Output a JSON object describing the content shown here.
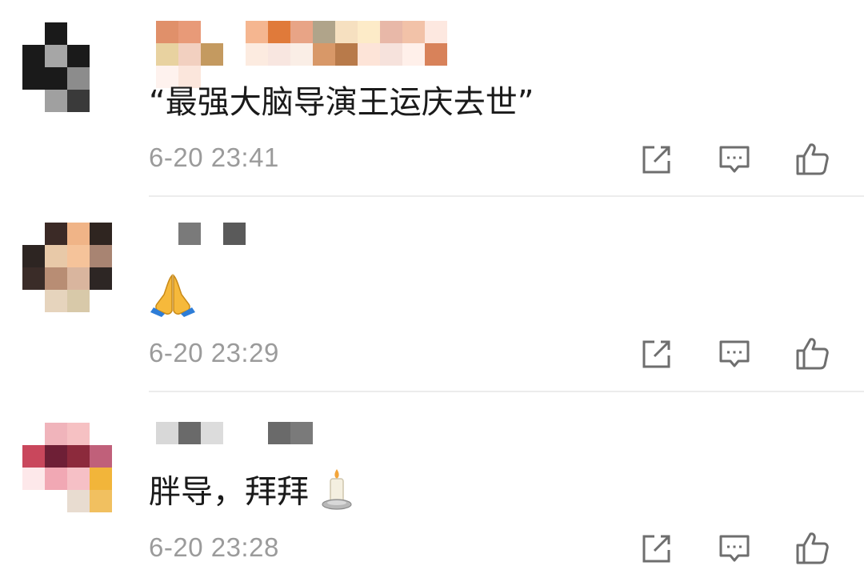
{
  "comments": [
    {
      "content": "“最强大脑导演王运庆去世”",
      "time": "6-20 23:41",
      "avatar_colors": [
        "#ffffff",
        "#1a1a1a",
        "#ffffff",
        "#ffffff",
        "#1a1a1a",
        "#a6a6a6",
        "#1a1a1a",
        "#ffffff",
        "#1a1a1a",
        "#1a1a1a",
        "#8c8c8c",
        "#ffffff",
        "#ffffff",
        "#a0a0a0",
        "#3a3a3a",
        "#ffffff"
      ]
    },
    {
      "content_emoji": "folded-hands-emoji",
      "time": "6-20 23:29",
      "avatar_colors": [
        "#ffffff",
        "#3b2a26",
        "#f0b487",
        "#2f2520",
        "#2d2522",
        "#e8c9a8",
        "#f5c39a",
        "#a88472",
        "#3a2c28",
        "#b88d74",
        "#d9b59e",
        "#2d2624",
        "#ffffff",
        "#e6d4bd",
        "#d8c9a9",
        "#ffffff"
      ]
    },
    {
      "content": "胖导，拜拜",
      "content_emoji": "candle-emoji",
      "time": "6-20 23:28",
      "avatar_colors": [
        "#ffffff",
        "#f0b4bb",
        "#f6c1c3",
        "#ffffff",
        "#c9475c",
        "#6e1f36",
        "#8c2a3c",
        "#c0607a",
        "#fde8ea",
        "#f1a8b4",
        "#f6c0c6",
        "#f2b53a",
        "#ffffff",
        "#ffffff",
        "#e8dcd0",
        "#f1c060"
      ]
    }
  ],
  "colors": {
    "time_text": "#9b9b9b",
    "divider": "#ececec",
    "icon_stroke": "#6e6e6e"
  },
  "icons": [
    "share-icon",
    "reply-icon",
    "like-icon"
  ]
}
